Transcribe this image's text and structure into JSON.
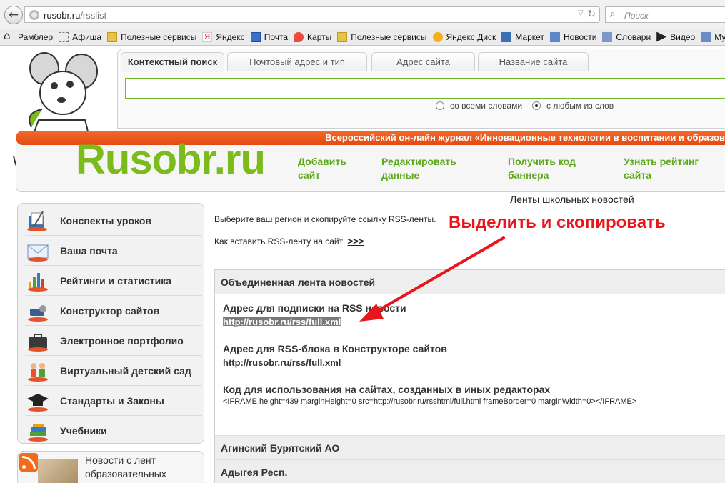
{
  "browser": {
    "url_host": "rusobr.ru",
    "url_path": "/rsslist",
    "search_placeholder": "Поиск",
    "bookmarks": [
      {
        "label": "Рамблер",
        "icon": "home-icon"
      },
      {
        "label": "Афиша",
        "icon": "blank-page-icon"
      },
      {
        "label": "Полезные сервисы",
        "icon": "folder-icon"
      },
      {
        "label": "Яндекс",
        "icon": "yandex-icon"
      },
      {
        "label": "Почта",
        "icon": "mail-icon"
      },
      {
        "label": "Карты",
        "icon": "map-icon"
      },
      {
        "label": "Полезные сервисы",
        "icon": "folder-icon"
      },
      {
        "label": "Яндекс.Диск",
        "icon": "disk-icon"
      },
      {
        "label": "Маркет",
        "icon": "market-icon"
      },
      {
        "label": "Новости",
        "icon": "news-icon"
      },
      {
        "label": "Словари",
        "icon": "dictionary-icon"
      },
      {
        "label": "Видео",
        "icon": "video-icon"
      },
      {
        "label": "Муз",
        "icon": "music-icon"
      }
    ]
  },
  "search": {
    "tabs": [
      "Контекстный поиск",
      "Почтовый адрес и тип",
      "Адрес сайта",
      "Название сайта"
    ],
    "active_tab": 0,
    "input_value": "",
    "radio_all": "со всеми словами",
    "radio_any": "с любым из слов",
    "radio_selected": "any"
  },
  "header": {
    "banner": "Всероссийский он-лайн журнал «Инновационные технологии в воспитании и образова",
    "logo": "Rusobr.ru",
    "links": [
      [
        "Добавить",
        "сайт"
      ],
      [
        "Редактировать",
        "данные"
      ],
      [
        "Получить код",
        "баннера"
      ],
      [
        "Узнать рейтинг",
        "сайта"
      ]
    ]
  },
  "page": {
    "subtitle": "Ленты школьных новостей",
    "intro": "Выберите ваш регион и скопируйте ссылку RSS-ленты.",
    "howto": "Как вставить RSS-ленту на сайт",
    "howto_more": ">>>",
    "overlay_title": "Выделить и скопировать"
  },
  "sidebar": {
    "items": [
      {
        "label": "Конспекты уроков",
        "icon": "notebook-pen-icon"
      },
      {
        "label": "Ваша почта",
        "icon": "envelope-icon"
      },
      {
        "label": "Рейтинги и статистика",
        "icon": "bar-chart-icon"
      },
      {
        "label": "Конструктор сайтов",
        "icon": "builder-tools-icon"
      },
      {
        "label": "Электронное портфолио",
        "icon": "briefcase-icon"
      },
      {
        "label": "Виртуальный детский сад",
        "icon": "children-icon"
      },
      {
        "label": "Стандарты и Законы",
        "icon": "graduation-cap-icon"
      },
      {
        "label": "Учебники",
        "icon": "books-icon"
      }
    ],
    "rss_text": [
      "Новости с лент",
      "образовательных"
    ]
  },
  "feed": {
    "title": "Объединенная лента новостей",
    "label_rss": "Адрес для подписки на RSS новости",
    "url_rss": "http://rusobr.ru/rss/full.xml",
    "label_block": "Адрес для RSS-блока в Конструкторе сайтов",
    "url_block": "http://rusobr.ru/rss/full.xml",
    "label_code": "Код для использования на сайтах, созданных в иных редакторах",
    "code": "<IFRAME height=439 marginHeight=0 src=http://rusobr.ru/rsshtml/full.html frameBorder=0 marginWidth=0></IFRAME>"
  },
  "regions": [
    "Агинский Бурятский АО",
    "Адыгея Респ."
  ],
  "colors": {
    "brand_green": "#7bbb1c",
    "banner_orange": "#e8581c",
    "annotation_red": "#e8161c"
  }
}
